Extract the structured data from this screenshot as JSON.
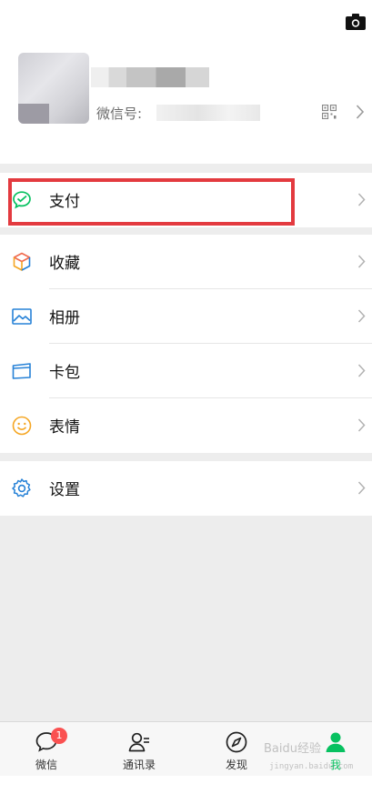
{
  "profile": {
    "wechat_id_label": "微信号:",
    "icons": {
      "camera": "camera-icon",
      "qr": "qr-code-icon",
      "arrow": "chevron-right-icon"
    }
  },
  "menu": {
    "pay": {
      "label": "支付",
      "icon": "wechat-pay-icon",
      "accent": "#07c160",
      "highlight_color": "#e33a3f"
    },
    "favorites": {
      "label": "收藏",
      "icon": "favorites-cube-icon"
    },
    "album": {
      "label": "相册",
      "icon": "album-photo-icon",
      "accent": "#2782d7"
    },
    "cards": {
      "label": "卡包",
      "icon": "card-wallet-icon",
      "accent": "#2782d7"
    },
    "stickers": {
      "label": "表情",
      "icon": "sticker-smiley-icon",
      "accent": "#f5a623"
    },
    "settings": {
      "label": "设置",
      "icon": "settings-gear-icon",
      "accent": "#2782d7"
    }
  },
  "tabbar": {
    "chats": {
      "label": "微信",
      "badge": "1",
      "icon": "chat-bubble-icon"
    },
    "contacts": {
      "label": "通讯录",
      "icon": "contacts-icon"
    },
    "discover": {
      "label": "发现",
      "icon": "compass-icon"
    },
    "me": {
      "label": "我",
      "icon": "person-icon",
      "active": true,
      "accent": "#07c160"
    }
  },
  "watermark": {
    "text": "Baidu经验",
    "sub": "jingyan.baidu.com"
  }
}
